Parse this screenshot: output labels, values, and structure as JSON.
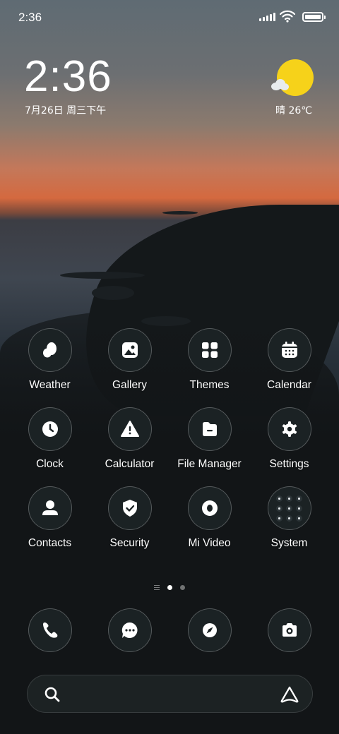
{
  "status": {
    "time": "2:36"
  },
  "lockclock": {
    "time": "2:36",
    "date": "7月26日 周三下午"
  },
  "weather": {
    "text": "晴 26℃"
  },
  "apps": [
    {
      "label": "Weather",
      "icon": "weather-icon"
    },
    {
      "label": "Gallery",
      "icon": "gallery-icon"
    },
    {
      "label": "Themes",
      "icon": "themes-icon"
    },
    {
      "label": "Calendar",
      "icon": "calendar-icon"
    },
    {
      "label": "Clock",
      "icon": "clock-icon"
    },
    {
      "label": "Calculator",
      "icon": "calculator-icon"
    },
    {
      "label": "File Manager",
      "icon": "file-manager-icon"
    },
    {
      "label": "Settings",
      "icon": "settings-icon"
    },
    {
      "label": "Contacts",
      "icon": "contacts-icon"
    },
    {
      "label": "Security",
      "icon": "security-icon"
    },
    {
      "label": "Mi Video",
      "icon": "video-icon"
    },
    {
      "label": "System",
      "icon": "system-folder-icon"
    }
  ],
  "dock": [
    {
      "icon": "phone-icon"
    },
    {
      "icon": "messages-icon"
    },
    {
      "icon": "browser-icon"
    },
    {
      "icon": "camera-icon"
    }
  ],
  "page_indicator": {
    "current": 1,
    "total": 2
  },
  "colors": {
    "icon_bg": "#1b2224",
    "sun": "#f6d21a"
  }
}
